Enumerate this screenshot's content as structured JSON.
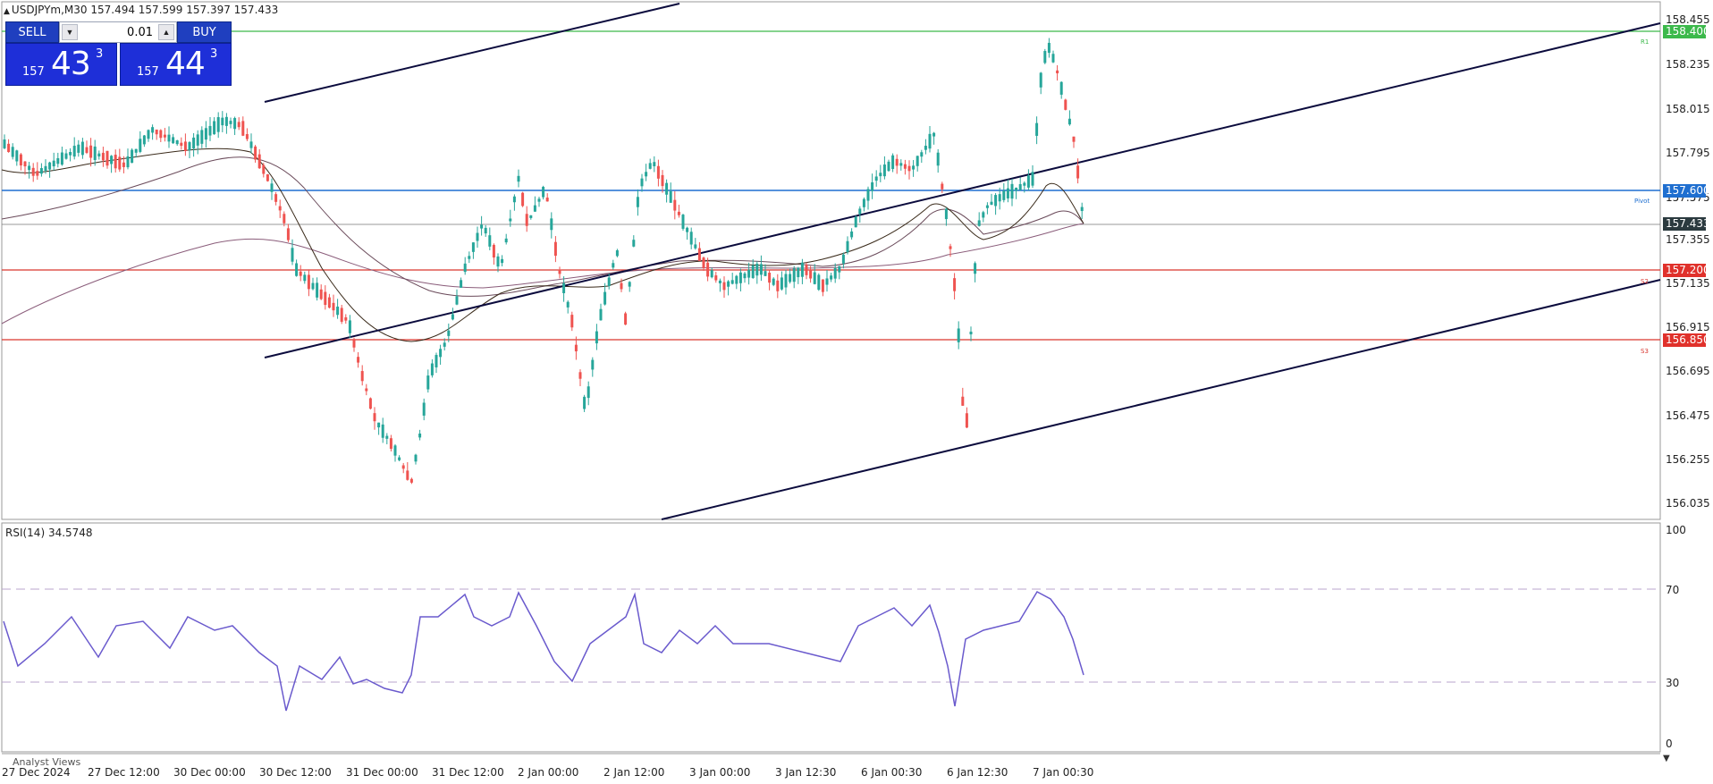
{
  "symbol_header": {
    "text": "USDJPYm,M30  157.494 157.599 157.397 157.433"
  },
  "trade_panel": {
    "sell_label": "SELL",
    "buy_label": "BUY",
    "lot_value": "0.01",
    "sell_price_prefix": "157",
    "sell_price_big": "43",
    "sell_price_sup": "3",
    "buy_price_prefix": "157",
    "buy_price_big": "44",
    "buy_price_sup": "3"
  },
  "price_axis_labels": [
    "158.455",
    "158.235",
    "158.015",
    "157.795",
    "157.575",
    "157.355",
    "157.135",
    "156.915",
    "156.695",
    "156.475",
    "156.255",
    "156.035"
  ],
  "price_tags": {
    "r1": "158.400",
    "pivot": "157.600",
    "current": "157.433",
    "s2": "157.200",
    "s3": "156.850"
  },
  "level_labels": {
    "r1": "R1",
    "pivot": "Pivot",
    "s2": "S2",
    "s3": "S3"
  },
  "rsi": {
    "label": "RSI(14) 34.5748",
    "levels": [
      "100",
      "70",
      "30",
      "0"
    ]
  },
  "time_axis_labels": [
    "27 Dec 2024",
    "27 Dec 12:00",
    "30 Dec 00:00",
    "30 Dec 12:00",
    "31 Dec 00:00",
    "31 Dec 12:00",
    "2 Jan 00:00",
    "2 Jan 12:00",
    "3 Jan 00:00",
    "3 Jan 12:30",
    "6 Jan 00:30",
    "6 Jan 12:30",
    "7 Jan 00:30"
  ],
  "analyst_label": "Analyst Views",
  "colors": {
    "bull": "#26a69a",
    "bear": "#ef5350",
    "r1_line": "#3cb94b",
    "pivot_line": "#1f6fd0",
    "support_line": "#d9362f",
    "channel": "#0b0b3d",
    "rsi_line": "#6a5acd"
  }
}
